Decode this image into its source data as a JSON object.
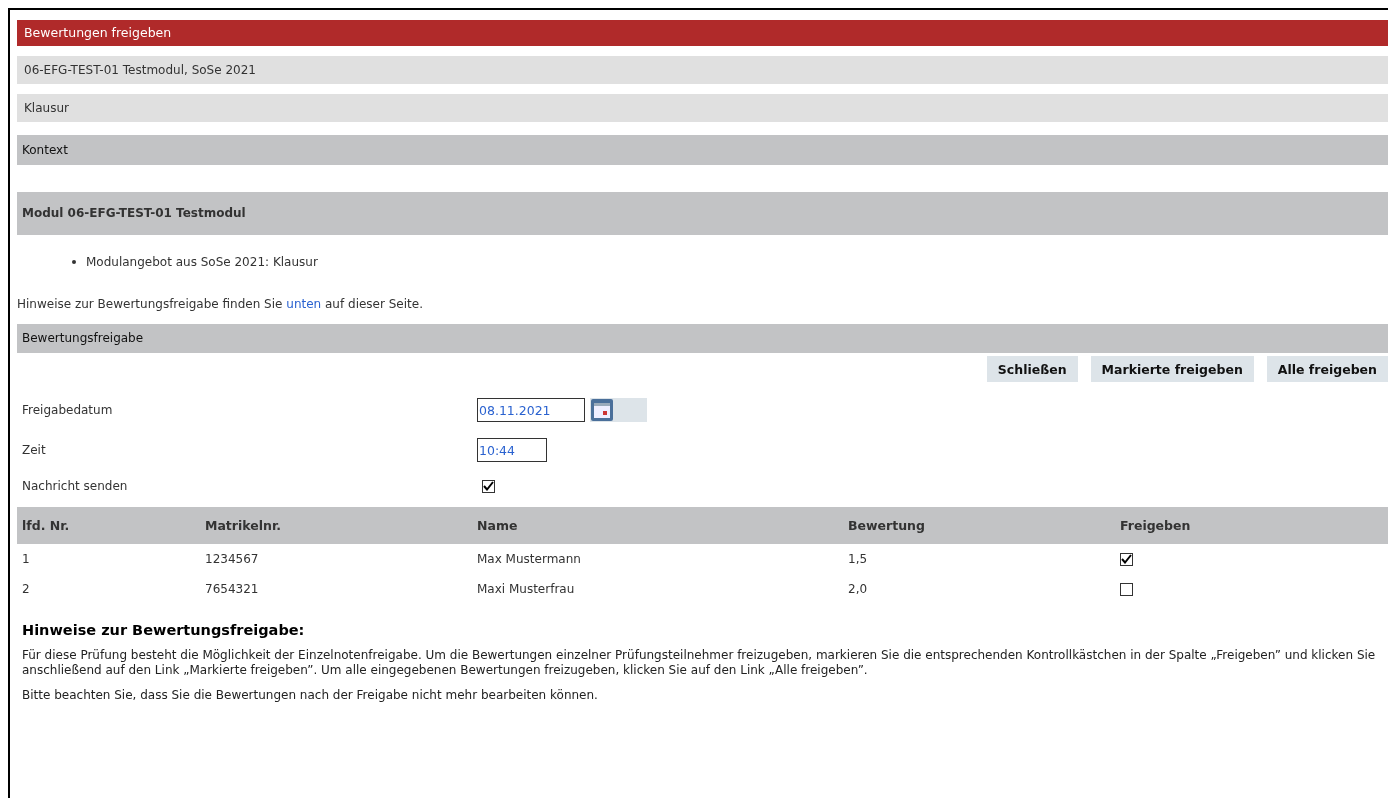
{
  "title": "Bewertungen freigeben",
  "info_rows": [
    "06-EFG-TEST-01 Testmodul, SoSe 2021",
    "Klausur"
  ],
  "context_heading": "Kontext",
  "module_heading": "Modul 06-EFG-TEST-01 Testmodul",
  "module_items": [
    "Modulangebot aus SoSe 2021: Klausur"
  ],
  "hint_line": {
    "before": "Hinweise zur Bewertungsfreigabe finden Sie",
    "link": "unten",
    "after": "auf dieser Seite."
  },
  "section_heading": "Bewertungsfreigabe",
  "buttons": [
    "Schließen",
    "Markierte freigeben",
    "Alle freigeben"
  ],
  "form": [
    {
      "kind": "date",
      "label": "Freigabedatum",
      "value": "08.11.2021"
    },
    {
      "kind": "time",
      "label": "Zeit",
      "value": "10:44"
    },
    {
      "kind": "checkbox",
      "label": "Nachricht senden",
      "checked": true
    }
  ],
  "table": {
    "columns": [
      "lfd. Nr.",
      "Matrikelnr.",
      "Name",
      "Bewertung",
      "Freigeben"
    ],
    "rows": [
      {
        "cells": [
          "1",
          "1234567",
          "Max Mustermann",
          "1,5"
        ],
        "checked": true
      },
      {
        "cells": [
          "2",
          "7654321",
          "Maxi Musterfrau",
          "2,0"
        ],
        "checked": false
      }
    ]
  },
  "notes_heading": "Hinweise zur Bewertungsfreigabe:",
  "notes": [
    "Für diese Prüfung besteht die Möglichkeit der Einzelnotenfreigabe. Um die Bewertungen einzelner Prüfungsteilnehmer freizugeben, markieren Sie die entsprechenden Kontrollkästchen in der Spalte „Freigeben” und klicken Sie anschließend auf den Link „Markierte freigeben”. Um alle eingegebenen Bewertungen freizugeben, klicken Sie auf den Link „Alle freigeben”.",
    "Bitte beachten Sie, dass Sie die Bewertungen nach der Freigabe nicht mehr bearbeiten können."
  ]
}
